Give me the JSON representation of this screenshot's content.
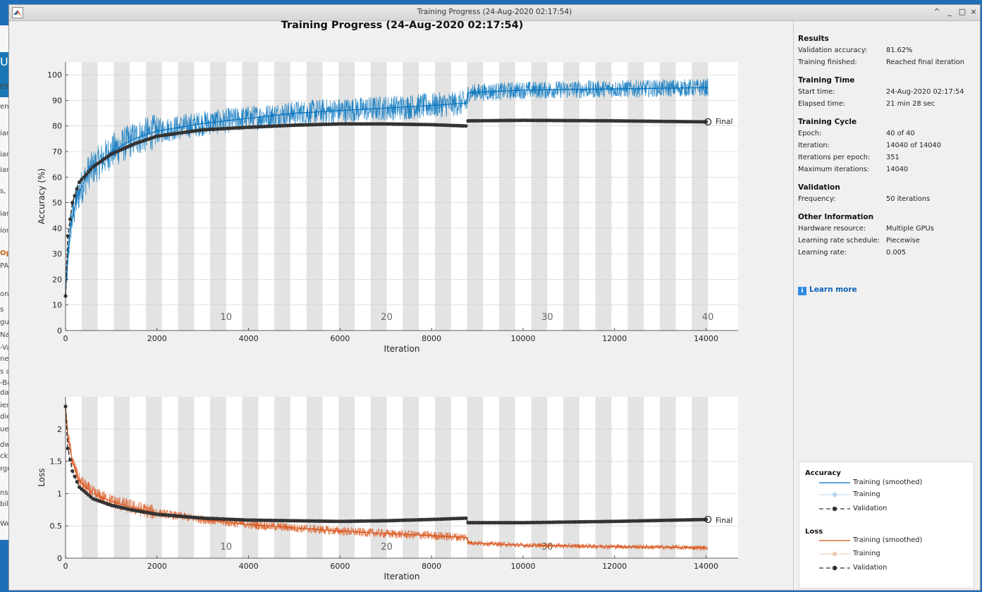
{
  "window": {
    "title": "Training Progress (24-Aug-2020 02:17:54)",
    "buttons": [
      "^",
      "_",
      "□",
      "×"
    ]
  },
  "figure_title": "Training Progress (24-Aug-2020 02:17:54)",
  "background_fragments": [
    "UI",
    "EN",
    "ent",
    "iar",
    "iar",
    "iar",
    "s, a",
    "iar",
    "ion",
    "Op",
    "PA",
    "on",
    "s",
    "gu",
    "Na",
    "-Va",
    "ne",
    "s a",
    "-Ba",
    "dat",
    "ier",
    "die",
    "ue",
    "dw",
    "ck",
    "rgu",
    "ns",
    "bil",
    "We"
  ],
  "results": {
    "sections": [
      {
        "title": "Results",
        "rows": [
          [
            "Validation accuracy:",
            "81.62%"
          ],
          [
            "Training finished:",
            "Reached final iteration"
          ]
        ]
      },
      {
        "title": "Training Time",
        "rows": [
          [
            "Start time:",
            "24-Aug-2020 02:17:54"
          ],
          [
            "Elapsed time:",
            "21 min 28 sec"
          ]
        ]
      },
      {
        "title": "Training Cycle",
        "rows": [
          [
            "Epoch:",
            "40 of 40"
          ],
          [
            "Iteration:",
            "14040 of 14040"
          ],
          [
            "Iterations per epoch:",
            "351"
          ],
          [
            "Maximum iterations:",
            "14040"
          ]
        ]
      },
      {
        "title": "Validation",
        "rows": [
          [
            "Frequency:",
            "50 iterations"
          ]
        ]
      },
      {
        "title": "Other Information",
        "rows": [
          [
            "Hardware resource:",
            "Multiple GPUs"
          ],
          [
            "Learning rate schedule:",
            "Piecewise"
          ],
          [
            "Learning rate:",
            "0.005"
          ]
        ]
      }
    ],
    "learn_more": "Learn more"
  },
  "legend": {
    "accuracy_title": "Accuracy",
    "loss_title": "Loss",
    "items_accuracy": [
      "Training (smoothed)",
      "Training",
      "Validation"
    ],
    "items_loss": [
      "Training (smoothed)",
      "Training",
      "Validation"
    ]
  },
  "colors": {
    "accuracy_line": "#0072bd",
    "loss_line": "#d95319",
    "validation": "#333333",
    "epoch_band": "#e3e3e3"
  },
  "chart_data": [
    {
      "type": "line",
      "xlabel": "Iteration",
      "ylabel": "Accuracy (%)",
      "xlim": [
        0,
        14700
      ],
      "ylim": [
        0,
        105
      ],
      "xticks": [
        0,
        2000,
        4000,
        6000,
        8000,
        10000,
        12000,
        14000
      ],
      "yticks": [
        0,
        10,
        20,
        30,
        40,
        50,
        60,
        70,
        80,
        90,
        100
      ],
      "epoch_labels": [
        "10",
        "20",
        "30",
        "40"
      ],
      "final_label": "Final",
      "iterations_per_epoch": 351,
      "series": [
        {
          "name": "Training (smoothed)",
          "x": [
            0,
            100,
            250,
            500,
            1000,
            1500,
            2000,
            3000,
            4000,
            5000,
            6000,
            7000,
            8000,
            8780,
            8800,
            10000,
            12000,
            14040
          ],
          "y": [
            15,
            40,
            52,
            62,
            70,
            75,
            78,
            81,
            83,
            85,
            86,
            87,
            88,
            89,
            93,
            94,
            94.5,
            95
          ]
        },
        {
          "name": "Validation",
          "x": [
            0,
            50,
            150,
            300,
            600,
            1000,
            1500,
            2000,
            3000,
            4000,
            5000,
            6000,
            7000,
            8000,
            8750,
            8800,
            10000,
            12000,
            14040
          ],
          "y": [
            13.5,
            37,
            50,
            58,
            64,
            69,
            73,
            76,
            78.5,
            79.5,
            80.3,
            80.8,
            80.8,
            80.5,
            80,
            82,
            82.2,
            82,
            81.6
          ]
        }
      ]
    },
    {
      "type": "line",
      "xlabel": "Iteration",
      "ylabel": "Loss",
      "xlim": [
        0,
        14700
      ],
      "ylim": [
        0,
        2.5
      ],
      "xticks": [
        0,
        2000,
        4000,
        6000,
        8000,
        10000,
        12000,
        14000
      ],
      "yticks": [
        0,
        0.5,
        1,
        1.5,
        2
      ],
      "epoch_labels": [
        "10",
        "20",
        "30"
      ],
      "final_label": "Final",
      "series": [
        {
          "name": "Training (smoothed)",
          "x": [
            0,
            50,
            150,
            300,
            600,
            1000,
            1500,
            2000,
            3000,
            4000,
            5000,
            6000,
            7000,
            8000,
            8780,
            8800,
            10000,
            12000,
            14040
          ],
          "y": [
            2.35,
            1.9,
            1.5,
            1.2,
            1.0,
            0.88,
            0.78,
            0.7,
            0.6,
            0.52,
            0.47,
            0.42,
            0.38,
            0.35,
            0.32,
            0.24,
            0.2,
            0.18,
            0.16
          ]
        },
        {
          "name": "Validation",
          "x": [
            0,
            50,
            150,
            300,
            600,
            1000,
            1500,
            2000,
            3000,
            4000,
            5000,
            6000,
            7000,
            8000,
            8750,
            8800,
            10000,
            12000,
            14040
          ],
          "y": [
            2.35,
            1.7,
            1.35,
            1.1,
            0.92,
            0.82,
            0.74,
            0.68,
            0.62,
            0.59,
            0.58,
            0.57,
            0.58,
            0.6,
            0.62,
            0.55,
            0.55,
            0.57,
            0.6
          ]
        }
      ]
    }
  ]
}
